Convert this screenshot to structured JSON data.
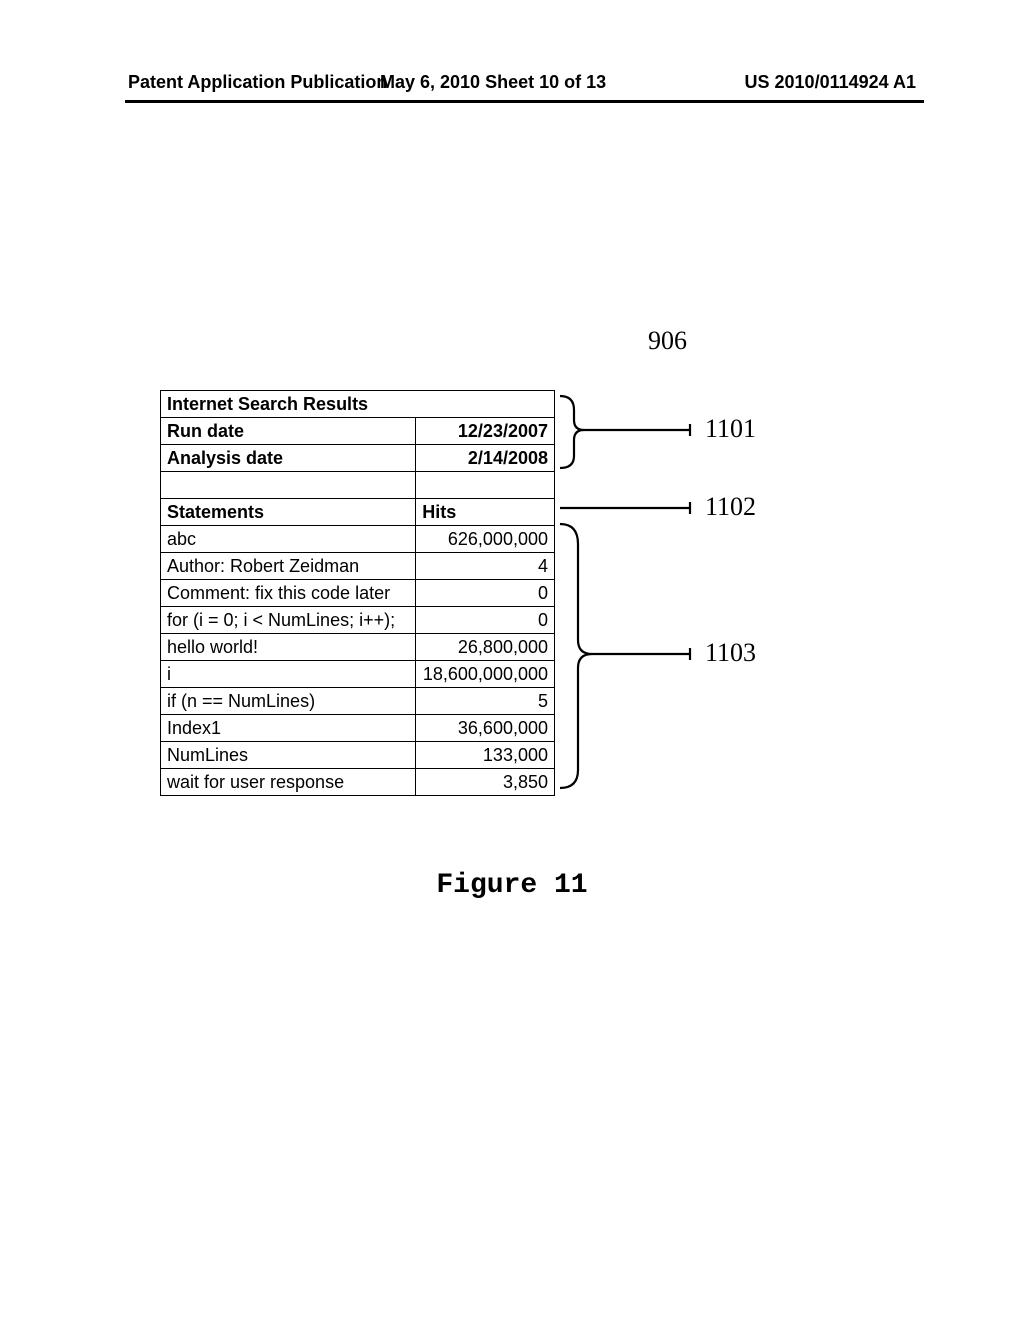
{
  "header": {
    "left": "Patent Application Publication",
    "mid": "May 6, 2010  Sheet 10 of 13",
    "right": "US 2010/0114924 A1"
  },
  "refs": {
    "r906": "906",
    "r1101": "1101",
    "r1102": "1102",
    "r1103": "1103"
  },
  "table": {
    "title": "Internet Search Results",
    "run_date_label": "Run date",
    "run_date_value": "12/23/2007",
    "analysis_date_label": "Analysis date",
    "analysis_date_value": "2/14/2008",
    "col_statements": "Statements",
    "col_hits": "Hits",
    "rows": [
      {
        "stmt": "abc",
        "hits": "626,000,000"
      },
      {
        "stmt": "Author: Robert Zeidman",
        "hits": "4"
      },
      {
        "stmt": "Comment: fix this code later",
        "hits": "0"
      },
      {
        "stmt": "for (i = 0; i < NumLines; i++);",
        "hits": "0"
      },
      {
        "stmt": "hello world!",
        "hits": "26,800,000"
      },
      {
        "stmt": "i",
        "hits": "18,600,000,000"
      },
      {
        "stmt": "if (n == NumLines)",
        "hits": "5"
      },
      {
        "stmt": "Index1",
        "hits": "36,600,000"
      },
      {
        "stmt": "NumLines",
        "hits": "133,000"
      },
      {
        "stmt": "wait for user response",
        "hits": "3,850"
      }
    ]
  },
  "caption": "Figure 11"
}
